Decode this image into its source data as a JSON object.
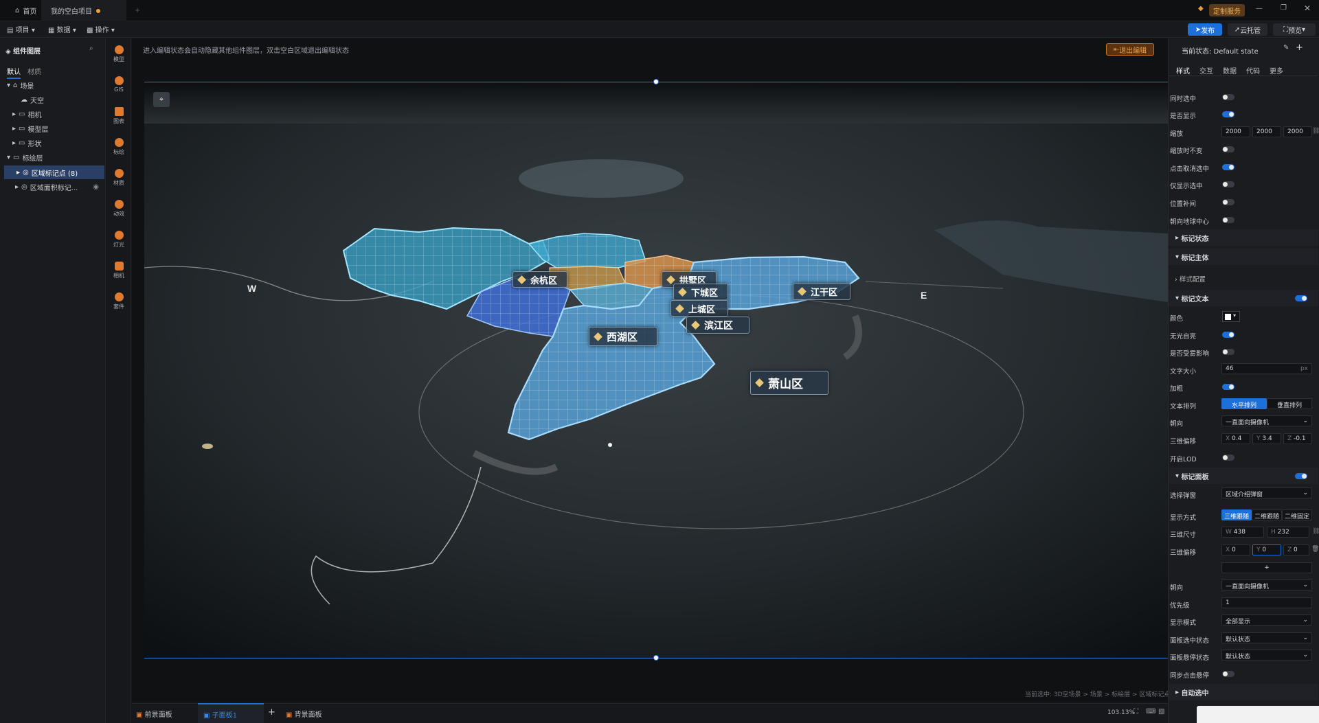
{
  "tabs": [
    {
      "label": "首页"
    },
    {
      "label": "我的空白项目"
    }
  ],
  "titlebar": {
    "custom_service": "定制服务"
  },
  "toolbar": {
    "project": "项目",
    "data": "数据",
    "operate": "操作",
    "publish": "发布",
    "cloud_host": "云托管",
    "preview": "预览"
  },
  "left_panel": {
    "title": "组件图层",
    "tabs": [
      "默认",
      "材质"
    ],
    "tree": [
      {
        "label": "场景"
      },
      {
        "label": "天空"
      },
      {
        "label": "相机"
      },
      {
        "label": "模型层"
      },
      {
        "label": "形状"
      },
      {
        "label": "标绘层"
      },
      {
        "label": "区域标记点 (8)"
      },
      {
        "label": "区域面积标记..."
      }
    ]
  },
  "icon_bar": [
    "模型",
    "GIS",
    "图表",
    "标绘",
    "材质",
    "动效",
    "灯光",
    "相机",
    "套件"
  ],
  "canvas": {
    "hint": "进入编辑状态会自动隐藏其他组件图层，双击空白区域退出编辑状态",
    "exit_button": "退出编辑",
    "compass_w": "W",
    "compass_e": "E",
    "labels": [
      "余杭区",
      "拱墅区",
      "下城区",
      "上城区",
      "江干区",
      "滨江区",
      "西湖区",
      "萧山区"
    ],
    "breadcrumb": "当前选中: 3D空场景 > 场景 > 标绘层 > 区域标记点"
  },
  "bottom_bar": {
    "tabs": [
      "前景面板",
      "子面板1",
      "背景面板"
    ],
    "zoom": "103.13%"
  },
  "right_panel": {
    "state_label": "当前状态: Default state",
    "tabs": [
      "样式",
      "交互",
      "数据",
      "代码",
      "更多"
    ],
    "rows": {
      "simultaneous_select": "同时选中",
      "visible": "是否显示",
      "scale": "缩放",
      "scale_x": "2000",
      "scale_y": "2000",
      "scale_z": "2000",
      "scale_invariant": "缩放时不变",
      "click_deselect": "点击取消选中",
      "show_selected_only": "仅显示选中",
      "position_tween": "位置补间",
      "face_globe_center": "朝向地球中心",
      "marker_state": "标记状态",
      "marker_body": "标记主体",
      "style_config": "样式配置",
      "marker_text": "标记文本",
      "color": "颜色",
      "no_light": "无光自亮",
      "affected_by_fog": "是否受雾影响",
      "font_size": "文字大小",
      "font_size_value": "46",
      "font_size_unit": "px",
      "bold": "加粗",
      "text_arrange": "文本排列",
      "horizontal": "水平排列",
      "vertical": "垂直排列",
      "facing": "朝向",
      "facing_value": "一直面向摄像机",
      "offset3d": "三维偏移",
      "offset_x": "0.4",
      "offset_y": "3.4",
      "offset_z": "-0.1",
      "lod": "开启LOD",
      "marker_panel": "标记面板",
      "popup": "选择弹窗",
      "popup_value": "区域介绍弹窗",
      "display_mode": "显示方式",
      "dm_3d_follow": "三维跟随",
      "dm_2d_follow": "二维跟随",
      "dm_2d_fixed": "二维固定",
      "size3d": "三维尺寸",
      "size_w": "438",
      "size_h": "232",
      "offset3d_2": "三维偏移",
      "off2_x": "0",
      "off2_y": "0",
      "off2_z": "0",
      "add": "+",
      "facing2": "朝向",
      "facing2_value": "一直面向摄像机",
      "priority": "优先级",
      "priority_value": "1",
      "show_mode": "显示模式",
      "show_mode_value": "全部显示",
      "panel_select_state": "面板选中状态",
      "panel_select_value": "默认状态",
      "panel_hover_state": "面板悬停状态",
      "panel_hover_value": "默认状态",
      "sync_click_hover": "同步点击悬停",
      "auto_select": "自动选中"
    }
  }
}
